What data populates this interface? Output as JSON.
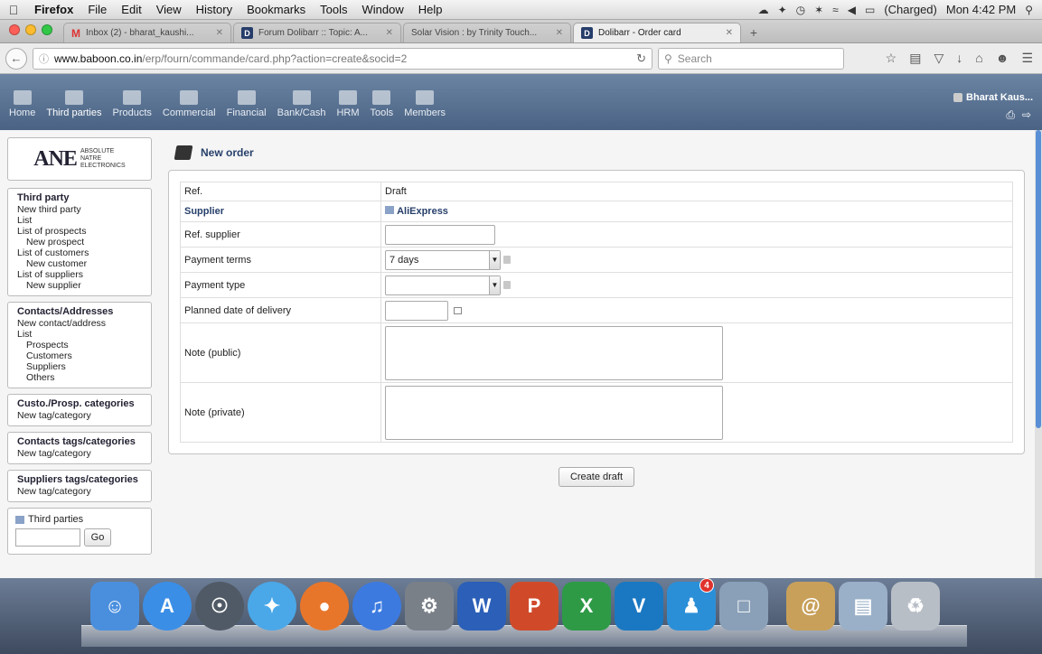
{
  "menubar": {
    "app": "Firefox",
    "items": [
      "File",
      "Edit",
      "View",
      "History",
      "Bookmarks",
      "Tools",
      "Window",
      "Help"
    ],
    "battery": "(Charged)",
    "clock": "Mon 4:42 PM"
  },
  "tabs": [
    {
      "label": "Inbox (2) - bharat_kaushi...",
      "favicon": "gmail-icon",
      "active": false
    },
    {
      "label": "Forum Dolibarr :: Topic: A...",
      "favicon": "dolibarr-icon",
      "active": false
    },
    {
      "label": "Solar Vision : by Trinity Touch...",
      "favicon": "none",
      "active": false
    },
    {
      "label": "Dolibarr - Order card",
      "favicon": "dolibarr-icon",
      "active": true
    }
  ],
  "navbar": {
    "url_host": "www.baboon.co.in",
    "url_path": "/erp/fourn/commande/card.php?action=create&socid=2",
    "search_placeholder": "Search"
  },
  "topmenu": {
    "items": [
      "Home",
      "Third parties",
      "Products",
      "Commercial",
      "Financial",
      "Bank/Cash",
      "HRM",
      "Tools",
      "Members"
    ],
    "active": "Third parties",
    "user": "Bharat Kaus..."
  },
  "sidebar": {
    "logo_big": "ANE",
    "logo_lines": [
      "ABSOLUTE",
      "NATRE",
      "ELECTRONICS"
    ],
    "blocks": [
      {
        "title": "Third party",
        "items": [
          {
            "label": "New third party",
            "indent": false
          },
          {
            "label": "List",
            "indent": false
          },
          {
            "label": "List of prospects",
            "indent": false
          },
          {
            "label": "New prospect",
            "indent": true
          },
          {
            "label": "List of customers",
            "indent": false
          },
          {
            "label": "New customer",
            "indent": true
          },
          {
            "label": "List of suppliers",
            "indent": false
          },
          {
            "label": "New supplier",
            "indent": true
          }
        ]
      },
      {
        "title": "Contacts/Addresses",
        "items": [
          {
            "label": "New contact/address",
            "indent": false
          },
          {
            "label": "List",
            "indent": false
          },
          {
            "label": "Prospects",
            "indent": true
          },
          {
            "label": "Customers",
            "indent": true
          },
          {
            "label": "Suppliers",
            "indent": true
          },
          {
            "label": "Others",
            "indent": true
          }
        ]
      },
      {
        "title": "Custo./Prosp. categories",
        "items": [
          {
            "label": "New tag/category",
            "indent": false
          }
        ]
      },
      {
        "title": "Contacts tags/categories",
        "items": [
          {
            "label": "New tag/category",
            "indent": false
          }
        ]
      },
      {
        "title": "Suppliers tags/categories",
        "items": [
          {
            "label": "New tag/category",
            "indent": false
          }
        ]
      }
    ],
    "search": {
      "title": "Third parties",
      "button": "Go",
      "value": ""
    }
  },
  "main": {
    "title": "New order",
    "form": {
      "ref_label": "Ref.",
      "ref_value": "Draft",
      "supplier_label": "Supplier",
      "supplier_value": "AliExpress",
      "ref_supplier_label": "Ref. supplier",
      "ref_supplier_value": "",
      "payment_terms_label": "Payment terms",
      "payment_terms_value": "7 days",
      "payment_type_label": "Payment type",
      "payment_type_value": "",
      "delivery_label": "Planned date of delivery",
      "delivery_value": "",
      "note_public_label": "Note (public)",
      "note_private_label": "Note (private)"
    },
    "create_button": "Create draft"
  },
  "dock": {
    "items": [
      "Finder",
      "App Store",
      "Launchpad",
      "Safari",
      "Firefox",
      "iTunes",
      "System Preferences",
      "Word",
      "PowerPoint",
      "Excel",
      "VNC",
      "Trinity",
      "Preview",
      "Address Book",
      "Documents",
      "Trash"
    ],
    "badge": "4"
  }
}
